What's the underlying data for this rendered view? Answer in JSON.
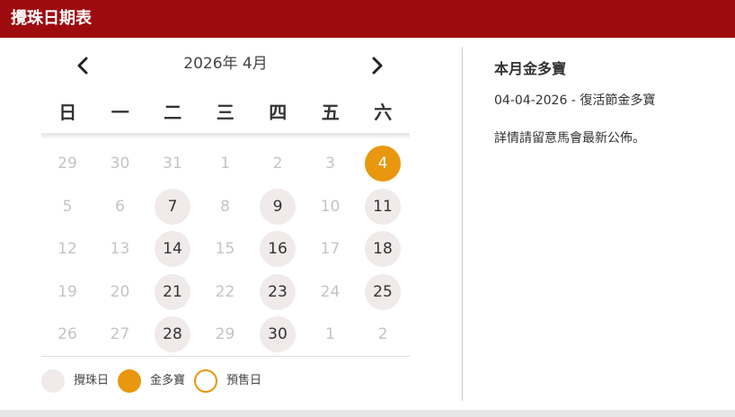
{
  "header": {
    "title": "攪珠日期表"
  },
  "calendar": {
    "month_label": "2026年 4月",
    "prev_icon": "chevron-left-icon",
    "next_icon": "chevron-right-icon",
    "weekdays": [
      "日",
      "一",
      "二",
      "三",
      "四",
      "五",
      "六"
    ],
    "weeks": [
      [
        {
          "d": "29",
          "t": "other"
        },
        {
          "d": "30",
          "t": "other"
        },
        {
          "d": "31",
          "t": "other"
        },
        {
          "d": "1",
          "t": "none"
        },
        {
          "d": "2",
          "t": "none"
        },
        {
          "d": "3",
          "t": "none"
        },
        {
          "d": "4",
          "t": "jackpot"
        }
      ],
      [
        {
          "d": "5",
          "t": "none"
        },
        {
          "d": "6",
          "t": "none"
        },
        {
          "d": "7",
          "t": "race"
        },
        {
          "d": "8",
          "t": "none"
        },
        {
          "d": "9",
          "t": "race"
        },
        {
          "d": "10",
          "t": "none"
        },
        {
          "d": "11",
          "t": "race"
        }
      ],
      [
        {
          "d": "12",
          "t": "none"
        },
        {
          "d": "13",
          "t": "none"
        },
        {
          "d": "14",
          "t": "race"
        },
        {
          "d": "15",
          "t": "none"
        },
        {
          "d": "16",
          "t": "race"
        },
        {
          "d": "17",
          "t": "none"
        },
        {
          "d": "18",
          "t": "race"
        }
      ],
      [
        {
          "d": "19",
          "t": "none"
        },
        {
          "d": "20",
          "t": "none"
        },
        {
          "d": "21",
          "t": "race"
        },
        {
          "d": "22",
          "t": "none"
        },
        {
          "d": "23",
          "t": "race"
        },
        {
          "d": "24",
          "t": "none"
        },
        {
          "d": "25",
          "t": "race"
        }
      ],
      [
        {
          "d": "26",
          "t": "none"
        },
        {
          "d": "27",
          "t": "none"
        },
        {
          "d": "28",
          "t": "race"
        },
        {
          "d": "29",
          "t": "none"
        },
        {
          "d": "30",
          "t": "race"
        },
        {
          "d": "1",
          "t": "other"
        },
        {
          "d": "2",
          "t": "other"
        }
      ]
    ]
  },
  "legend": {
    "race_label": "攪珠日",
    "jackpot_label": "金多寶",
    "presale_label": "預售日"
  },
  "side": {
    "title": "本月金多寶",
    "event": "04-04-2026 - 復活節金多寶",
    "note": "詳情請留意馬會最新公佈。"
  },
  "colors": {
    "header_bg": "#9e0b0f",
    "jackpot": "#e8970f",
    "race_day": "#f0eaea",
    "inactive_text": "#c4c4c4"
  }
}
